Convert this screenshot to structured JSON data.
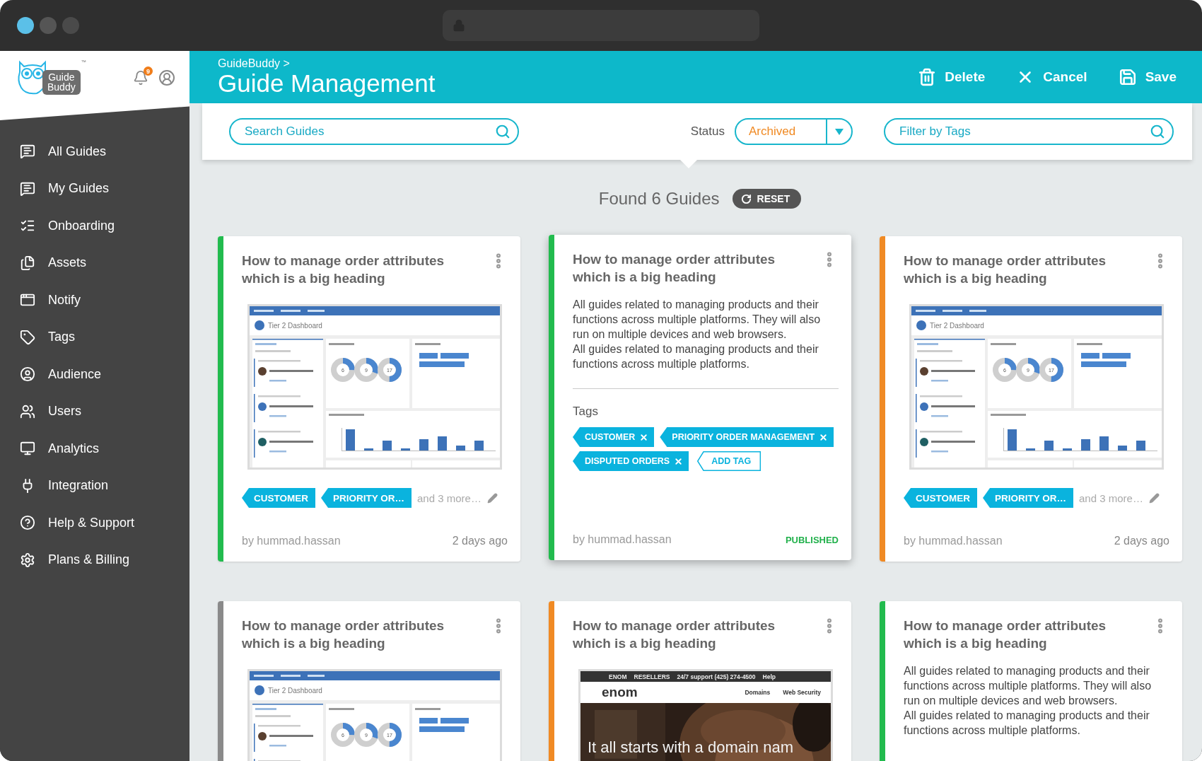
{
  "logo": {
    "lines": [
      "Guide",
      "Buddy"
    ],
    "mark": "™"
  },
  "notifications": {
    "count": "9"
  },
  "sidebar": {
    "items": [
      {
        "label": "All Guides"
      },
      {
        "label": "My Guides"
      },
      {
        "label": "Onboarding"
      },
      {
        "label": "Assets"
      },
      {
        "label": "Notify"
      },
      {
        "label": "Tags"
      },
      {
        "label": "Audience"
      },
      {
        "label": "Users"
      },
      {
        "label": "Analytics"
      },
      {
        "label": "Integration"
      },
      {
        "label": "Help & Support"
      },
      {
        "label": "Plans & Billing"
      }
    ]
  },
  "header": {
    "breadcrumb": "GuideBuddy >",
    "title": "Guide Management",
    "actions": [
      {
        "label": "Delete"
      },
      {
        "label": "Cancel"
      },
      {
        "label": "Save"
      }
    ]
  },
  "filters": {
    "search": {
      "placeholder": "Search Guides"
    },
    "status": {
      "label": "Status",
      "value": "Archived"
    },
    "tags": {
      "placeholder": "Filter by Tags"
    }
  },
  "results": {
    "summary": "Found 6 Guides",
    "reset": "RESET"
  },
  "cards": [
    {
      "color": "#22bb4e",
      "selected": false,
      "title": "How to manage order attributes which is a big heading",
      "thumbnail": {
        "kind": "dashboard",
        "title": "Tier 2 Dashboard",
        "donuts": [
          "6",
          "9",
          "17"
        ]
      },
      "tags": [
        {
          "label": "CUSTOMER",
          "removable": false
        },
        {
          "label": "PRIORITY OR…",
          "removable": false
        }
      ],
      "more": "and 3 more…",
      "author": "by hummad.hassan",
      "time": "2 days ago"
    },
    {
      "color": "#22bb4e",
      "selected": true,
      "title": "How to manage order attributes which is a big heading",
      "description": [
        "All guides related to managing products and their functions across multiple platforms. They will also run on multiple devices and web browsers.",
        "All guides related to managing products and their functions across multiple platforms."
      ],
      "tags_label": "Tags",
      "tags": [
        {
          "label": "CUSTOMER",
          "removable": true
        },
        {
          "label": "PRIORITY ORDER MANAGEMENT",
          "removable": true
        },
        {
          "label": "DISPUTED ORDERS",
          "removable": true
        }
      ],
      "add_tag": "ADD TAG",
      "author": "by hummad.hassan",
      "status": "PUBLISHED"
    },
    {
      "color": "#f08a24",
      "selected": false,
      "title": "How to manage order attributes which is a big heading",
      "thumbnail": {
        "kind": "dashboard",
        "title": "Tier 2 Dashboard",
        "donuts": [
          "6",
          "9",
          "17"
        ]
      },
      "tags": [
        {
          "label": "CUSTOMER",
          "removable": false
        },
        {
          "label": "PRIORITY OR…",
          "removable": false
        }
      ],
      "more": "and 3 more…",
      "author": "by hummad.hassan",
      "time": "2 days ago"
    },
    {
      "color": "#8a8a8a",
      "selected": false,
      "title": "How to manage order attributes which is a big heading",
      "thumbnail": {
        "kind": "dashboard",
        "title": "Tier 2 Dashboard",
        "donuts": [
          "6",
          "9",
          "17"
        ]
      }
    },
    {
      "color": "#f08a24",
      "selected": false,
      "title": "How to manage order attributes which is a big heading",
      "thumbnail": {
        "kind": "website",
        "nav": [
          "ENOM",
          "RESELLERS",
          "24/7 support (425) 274-4500",
          "Help"
        ],
        "logo": "enom",
        "links": [
          "Domains",
          "Web Security"
        ],
        "headline": "It all starts with a domain nam"
      }
    },
    {
      "color": "#22bb4e",
      "selected": false,
      "title": "How to manage order attributes which is a big heading",
      "description": [
        "All guides related to managing products and their functions across multiple platforms. They will also run on multiple devices and web browsers.",
        "All guides related to managing products and their functions across multiple platforms."
      ]
    }
  ]
}
